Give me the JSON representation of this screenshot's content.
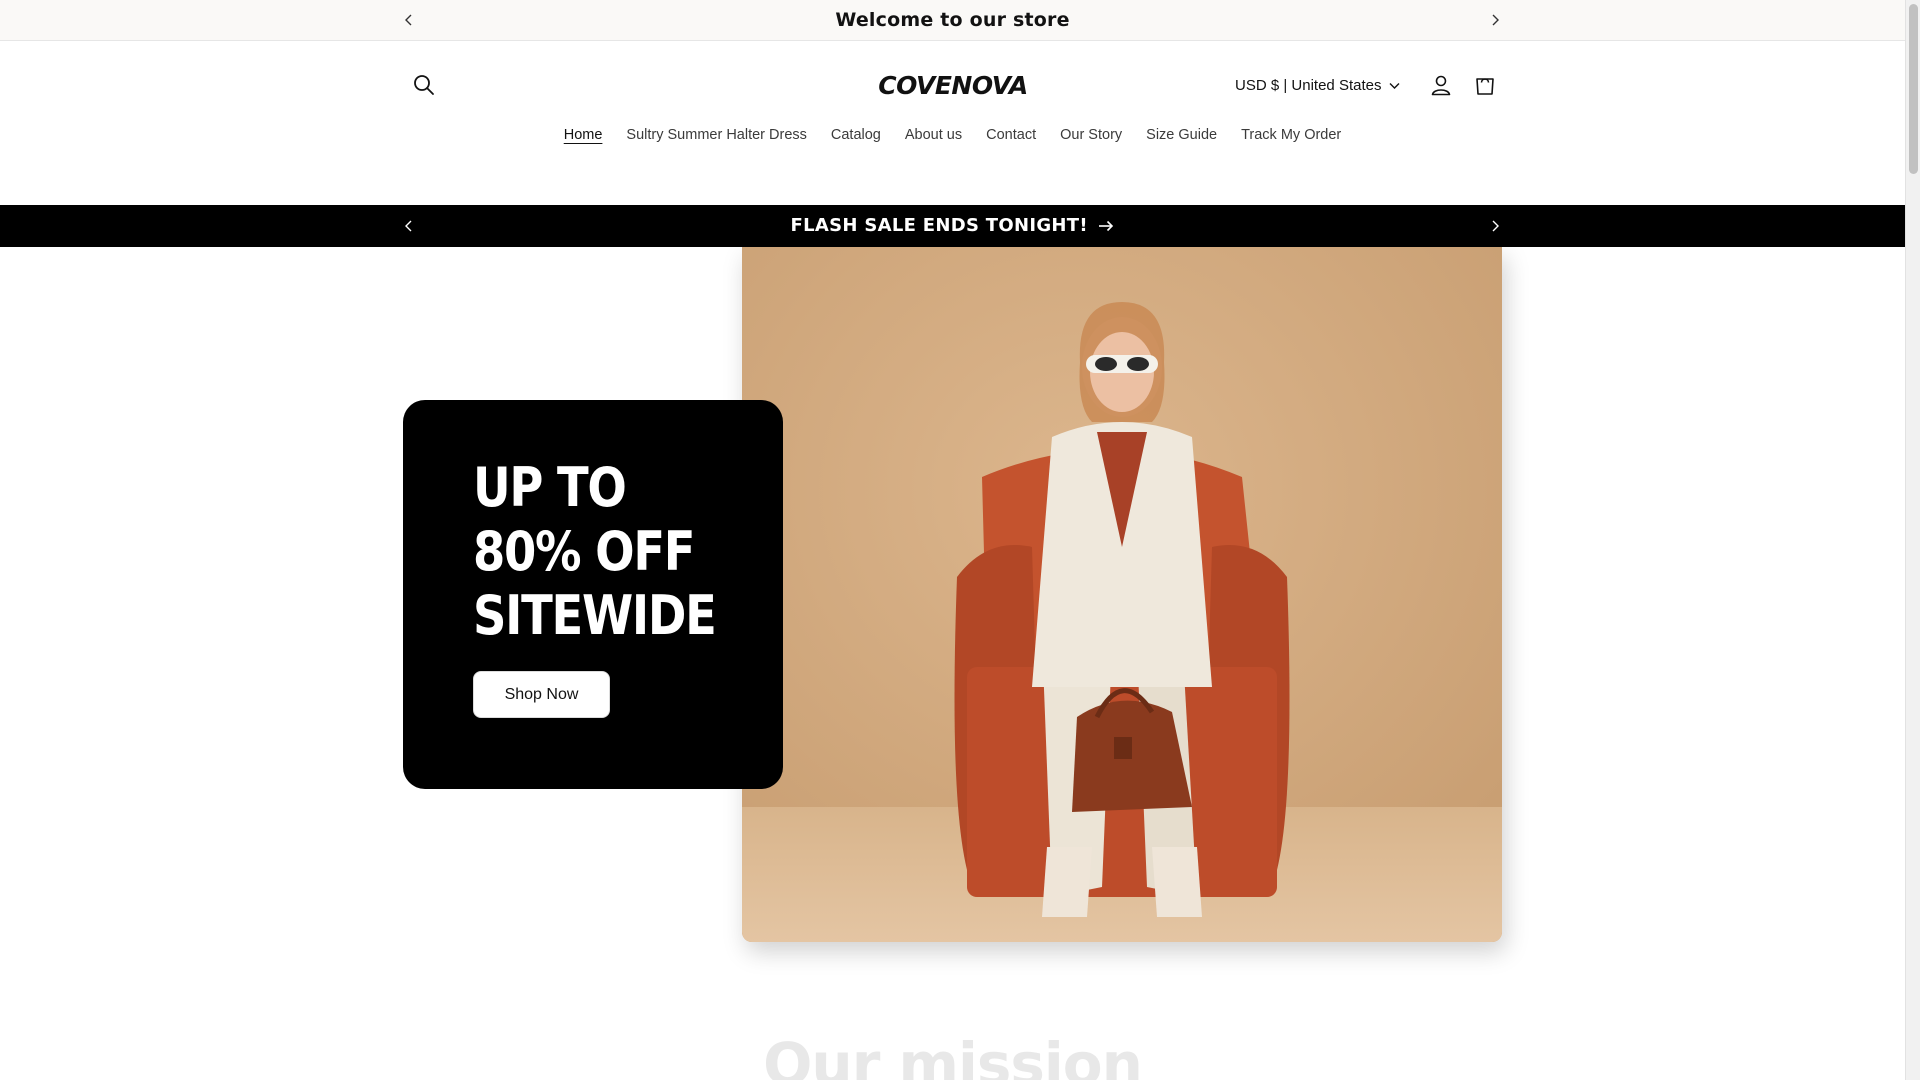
{
  "announcement": {
    "text": "Welcome to our store"
  },
  "header": {
    "logo": "COVENOVA",
    "currency": "USD $ | United States"
  },
  "nav": {
    "items": [
      {
        "label": "Home",
        "active": true
      },
      {
        "label": "Sultry Summer Halter Dress",
        "active": false
      },
      {
        "label": "Catalog",
        "active": false
      },
      {
        "label": "About us",
        "active": false
      },
      {
        "label": "Contact",
        "active": false
      },
      {
        "label": "Our Story",
        "active": false
      },
      {
        "label": "Size Guide",
        "active": false
      },
      {
        "label": "Track My Order",
        "active": false
      }
    ]
  },
  "promo": {
    "text": "FLASH SALE ENDS TONIGHT!"
  },
  "hero": {
    "heading_line1": "UP TO",
    "heading_line2": "80% OFF",
    "heading_line3": "SITEWIDE",
    "button_label": "Shop Now"
  },
  "mission": {
    "title": "Our mission"
  },
  "colors": {
    "promo_bg": "#000000",
    "announce_bg": "#faf9f7",
    "hero_card_bg": "#000000",
    "chair": "#c5532f",
    "suit": "#ece4d6",
    "backdrop": "#d4ad82"
  },
  "icons": [
    "chevron-left-icon",
    "chevron-right-icon",
    "search-icon",
    "account-icon",
    "cart-icon",
    "chevron-down-icon",
    "arrow-right-icon"
  ]
}
